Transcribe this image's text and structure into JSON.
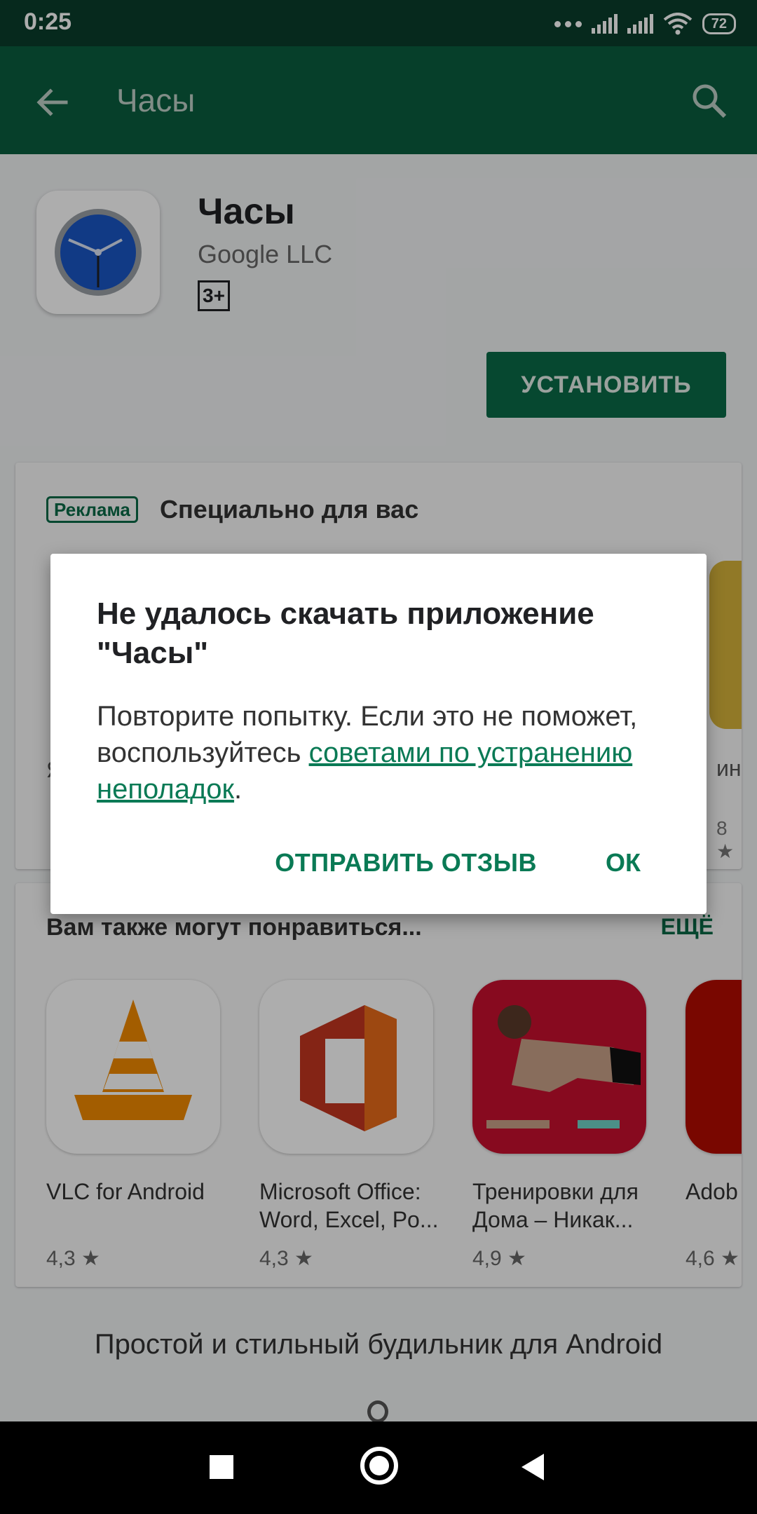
{
  "status_bar": {
    "time": "0:25",
    "battery": "72"
  },
  "app_bar": {
    "title": "Часы"
  },
  "app": {
    "name": "Часы",
    "developer": "Google LLC",
    "age_rating": "3+",
    "install_label": "УСТАНОВИТЬ"
  },
  "ad_section": {
    "badge": "Реклама",
    "title": "Специально для вас",
    "side_text": "ины",
    "side_rating": "8 ★",
    "left_fragment": "Я"
  },
  "similar": {
    "title": "Вам также могут понравиться...",
    "more": "ЕЩЁ",
    "items": [
      {
        "name": "VLC for Android",
        "rating": "4,3 ★"
      },
      {
        "name": "Microsoft Office: Word, Excel, Po...",
        "rating": "4,3 ★"
      },
      {
        "name": "Тренировки для Дома – Никак...",
        "rating": "4,9 ★"
      },
      {
        "name": "Adob Read",
        "rating": "4,6 ★"
      }
    ]
  },
  "description": "Простой и стильный будильник для Android",
  "dialog": {
    "title": "Не удалось скачать приложение \"Часы\"",
    "body_before": "Повторите попытку. Если это не поможет, воспользуйтесь ",
    "body_link": "советами по устранению неполадок",
    "body_after": ".",
    "feedback_button": "ОТПРАВИТЬ ОТЗЫВ",
    "ok_button": "ОК"
  },
  "colors": {
    "primary_green": "#0a5d3f",
    "accent_green": "#0a7a55"
  }
}
